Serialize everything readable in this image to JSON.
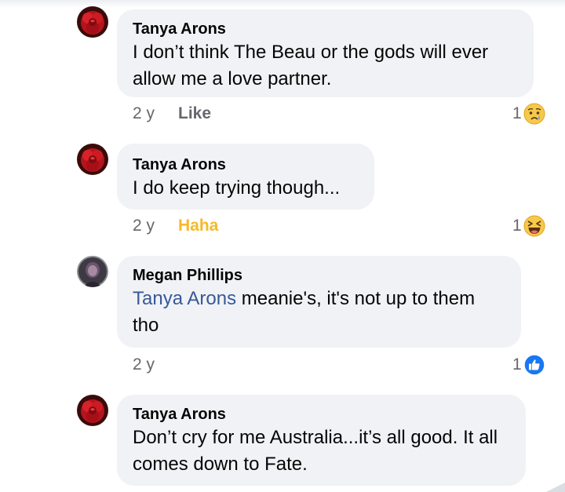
{
  "colors": {
    "bubble_bg": "#f0f2f5",
    "meta_text": "#65676b",
    "mention": "#385898",
    "haha_label": "#f7b928",
    "like_blue": "#1877f2"
  },
  "comments": [
    {
      "author": "Tanya Arons",
      "avatar_icon": "red-rose-avatar-icon",
      "text": "I don’t think The Beau or the gods will ever allow me a love partner.",
      "age": "2 y",
      "action": "Like",
      "reaction_count": "1",
      "reaction_icon": "sad-reaction-icon"
    },
    {
      "author": "Tanya Arons",
      "avatar_icon": "red-rose-avatar-icon",
      "text": "I do keep trying though...",
      "age": "2 y",
      "action": "Haha",
      "reaction_count": "1",
      "reaction_icon": "haha-reaction-icon"
    },
    {
      "author": "Megan Phillips",
      "avatar_icon": "portrait-avatar-icon",
      "mention": "Tanya Arons",
      "text": "meanie's, it's not up to them tho",
      "age": "2 y",
      "reaction_count": "1",
      "reaction_icon": "like-reaction-icon"
    },
    {
      "author": "Tanya Arons",
      "avatar_icon": "red-rose-avatar-icon",
      "text": "Don’t cry for me Australia...it’s all good.  It all comes down to Fate."
    }
  ]
}
